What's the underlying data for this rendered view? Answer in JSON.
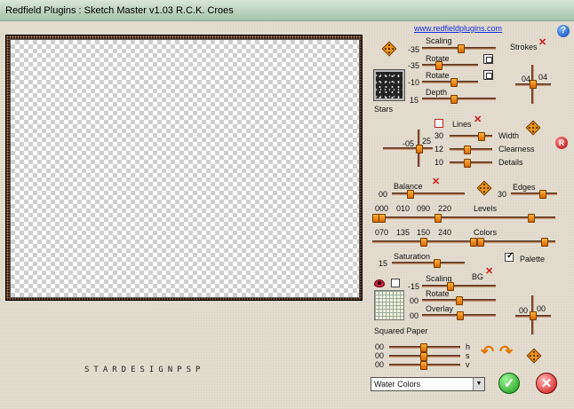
{
  "window": {
    "title": "Redfield Plugins : Sketch Master v1.03   R.C.K. Croes",
    "link": "www.redfieldplugins.com"
  },
  "icons": {
    "help": "?",
    "reset": "R"
  },
  "watermark": "STARDESIGNPSP",
  "strokes": {
    "scaling": {
      "label": "Scaling",
      "value": "-35"
    },
    "rotate1": {
      "label": "Rotate",
      "value": "-35"
    },
    "rotate2": {
      "label": "Rotate",
      "value": "-10"
    },
    "depth": {
      "label": "Depth",
      "value": "15"
    },
    "texture_label": "Stars",
    "group_label": "Strokes",
    "pad_x": "04",
    "pad_y": "04"
  },
  "lines": {
    "label": "Lines",
    "pad_value": "-05",
    "pad_value2": "25",
    "width": {
      "label": "Width",
      "value": "30"
    },
    "clearness": {
      "label": "Clearness",
      "value": "12"
    },
    "details": {
      "label": "Details",
      "value": "10"
    }
  },
  "balance": {
    "label": "Balance",
    "value": "00"
  },
  "edges": {
    "label": "Edges",
    "value": "30"
  },
  "levels": {
    "label": "Levels",
    "values": [
      "000",
      "010",
      "090",
      "220"
    ]
  },
  "colors": {
    "label": "Colors",
    "values": [
      "070",
      "135",
      "150",
      "240"
    ]
  },
  "saturation": {
    "label": "Saturation",
    "value": "15"
  },
  "palette": {
    "label": "Palette",
    "checked": true
  },
  "background": {
    "scaling": {
      "label": "Scaling",
      "value": "-15"
    },
    "bg_label": "BG",
    "rotate": {
      "label": "Rotate",
      "value": "00"
    },
    "overlay": {
      "label": "Overlay",
      "value": "00"
    },
    "texture_label": "Squared Paper",
    "pad_x": "00",
    "pad_y": "00"
  },
  "hsv": [
    {
      "label": "h",
      "value": "00"
    },
    {
      "label": "s",
      "value": "00"
    },
    {
      "label": "v",
      "value": "00"
    }
  ],
  "mode_select": {
    "selected": "Water Colors"
  },
  "buttons": {
    "ok": "✓",
    "cancel": "✕"
  }
}
